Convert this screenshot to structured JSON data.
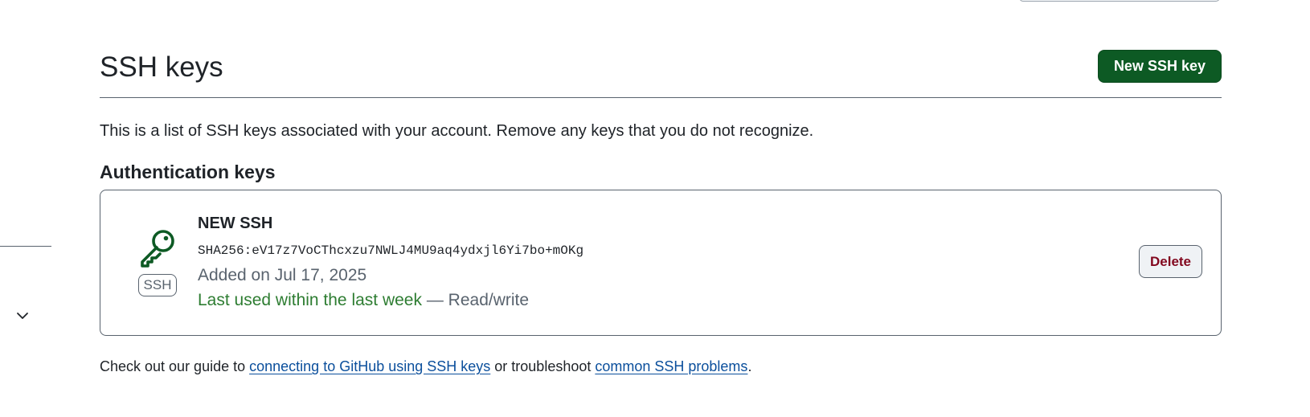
{
  "header": {
    "title": "SSH keys",
    "new_key_button": "New SSH key"
  },
  "intro": "This is a list of SSH keys associated with your account. Remove any keys that you do not recognize.",
  "auth_keys": {
    "heading": "Authentication keys",
    "items": [
      {
        "title": "NEW SSH",
        "type_badge": "SSH",
        "icon": "key-icon",
        "fingerprint": "SHA256:eV17z7VoCThcxzu7NWLJ4MU9aq4ydxjl6Yi7bo+mOKg",
        "added": "Added on Jul 17, 2025",
        "last_used": "Last used within the last week",
        "access": " — Read/write",
        "delete_label": "Delete"
      }
    ]
  },
  "footer": {
    "prefix": "Check out our guide to ",
    "guide_link": "connecting to GitHub using SSH keys",
    "middle": " or troubleshoot ",
    "problems_link": "common SSH problems",
    "suffix": "."
  },
  "sidebar": {
    "chevron_icon": "chevron-down-icon"
  },
  "colors": {
    "primary_button": "#0d5a24",
    "danger_text": "#82071e",
    "success_text": "#2e7d32",
    "link": "#0b4f9c",
    "muted_text": "#59636e"
  }
}
